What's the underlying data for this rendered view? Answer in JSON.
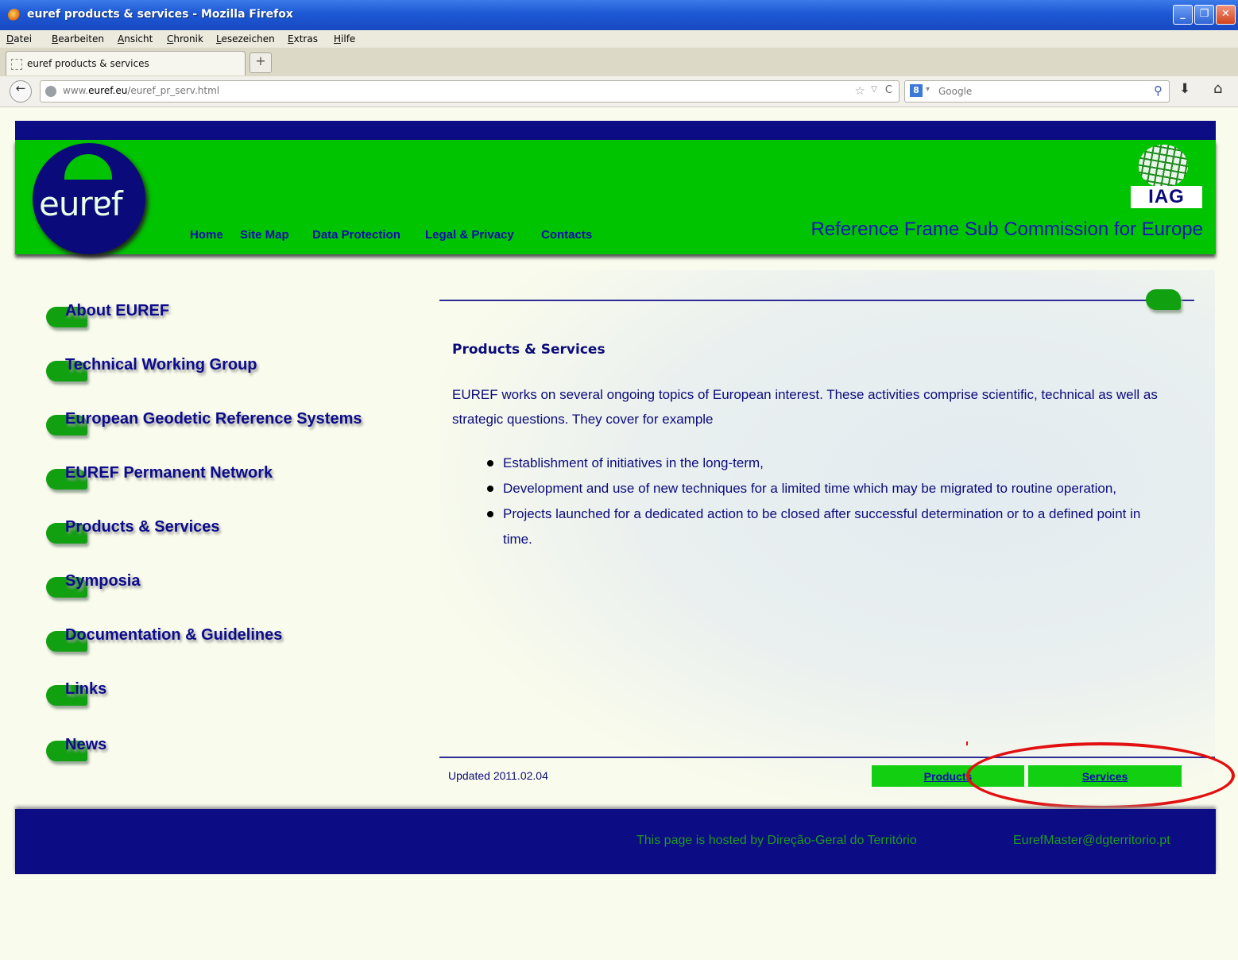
{
  "window": {
    "title": "euref products & services - Mozilla Firefox",
    "buttons": {
      "minimize": "_",
      "restore": "❐",
      "close": "✕"
    }
  },
  "menubar": [
    "Datei",
    "Bearbeiten",
    "Ansicht",
    "Chronik",
    "Lesezeichen",
    "Extras",
    "Hilfe"
  ],
  "tab": {
    "label": "euref products & services",
    "new_tab": "+"
  },
  "nav": {
    "back": "←",
    "url_prefix": "www.",
    "url_domain": "euref.eu",
    "url_path": "/euref_pr_serv.html",
    "star": "☆",
    "drop": "▽",
    "reload": "C",
    "search_engine": "8",
    "search_drop": "▾",
    "search_placeholder": "Google",
    "search_icon": "⚲",
    "download": "⬇",
    "home": "⌂"
  },
  "header": {
    "logo_text": "eurɐf",
    "nav": [
      "Home",
      "Site Map",
      "Data Protection",
      "Legal & Privacy",
      "Contacts"
    ],
    "iag": "IAG",
    "tagline": "Reference Frame Sub Commission for Europe"
  },
  "sidebar": [
    "About EUREF",
    "Technical Working Group",
    "European Geodetic Reference Systems",
    "EUREF Permanent Network",
    "Products & Services",
    "Symposia",
    "Documentation & Guidelines",
    "Links",
    "News"
  ],
  "main": {
    "title": "Products & Services",
    "intro": "EUREF works on several ongoing topics of European interest. These activities comprise scientific, technical as well as strategic questions. They cover for example",
    "bullets": [
      "Establishment of initiatives in the long-term,",
      "Development and use of new techniques for a limited time which may be migrated to routine operation,",
      "Projects launched for a dedicated action to be closed after successful determination or to a defined point in time."
    ],
    "updated": "Updated 2011.02.04",
    "buttons": {
      "products": "Products",
      "services": "Services"
    }
  },
  "footer": {
    "host": "This page is hosted by Direção-Geral do Território",
    "email": "EurefMaster@dgterritorio.pt"
  },
  "colors": {
    "header_green": "#00c400",
    "header_blue": "#0c0c84",
    "link_blue": "#0b0b8c",
    "annotation_red": "#e21010"
  },
  "icons": [
    "firefox-icon",
    "globe-icon",
    "star-icon",
    "reload-icon",
    "google-icon",
    "search-icon",
    "download-icon",
    "home-icon",
    "iag-globe-icon"
  ]
}
